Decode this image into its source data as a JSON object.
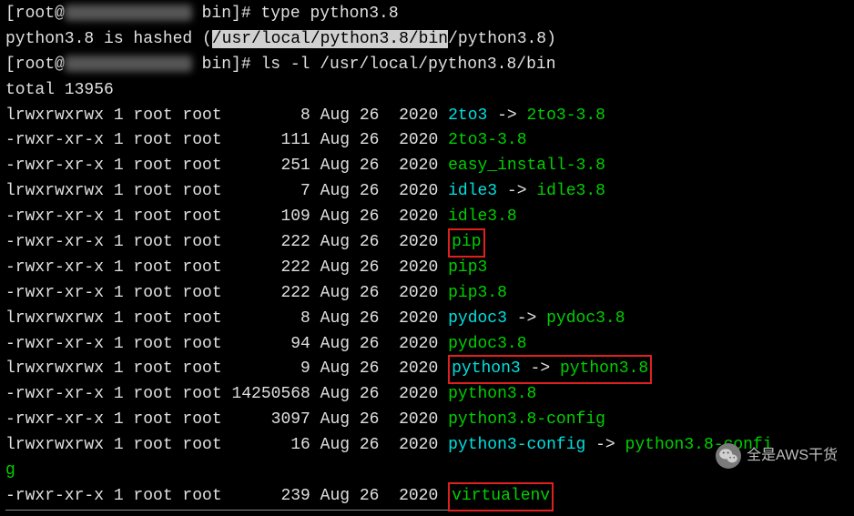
{
  "prompt_user": "root",
  "prompt_dir": "bin",
  "cmd1": "type python3.8",
  "hash_line_pre": "python3.8 is hashed (",
  "hash_highlight": "/usr/local/python3.8/bin",
  "hash_line_post": "/python3.8)",
  "cmd2": "ls -l /usr/local/python3.8/bin",
  "total_line": "total 13956",
  "rows": [
    {
      "perm": "lrwxrwxrwx",
      "links": "1",
      "owner": "root",
      "group": "root",
      "size": "       8",
      "date": "Aug 26  2020",
      "name": "2to3",
      "link": "2to3-3.8",
      "color": "cyan",
      "tcolor": "green"
    },
    {
      "perm": "-rwxr-xr-x",
      "links": "1",
      "owner": "root",
      "group": "root",
      "size": "     111",
      "date": "Aug 26  2020",
      "name": "2to3-3.8",
      "color": "green"
    },
    {
      "perm": "-rwxr-xr-x",
      "links": "1",
      "owner": "root",
      "group": "root",
      "size": "     251",
      "date": "Aug 26  2020",
      "name": "easy_install-3.8",
      "color": "green"
    },
    {
      "perm": "lrwxrwxrwx",
      "links": "1",
      "owner": "root",
      "group": "root",
      "size": "       7",
      "date": "Aug 26  2020",
      "name": "idle3",
      "link": "idle3.8",
      "color": "cyan",
      "tcolor": "green"
    },
    {
      "perm": "-rwxr-xr-x",
      "links": "1",
      "owner": "root",
      "group": "root",
      "size": "     109",
      "date": "Aug 26  2020",
      "name": "idle3.8",
      "color": "green"
    },
    {
      "perm": "-rwxr-xr-x",
      "links": "1",
      "owner": "root",
      "group": "root",
      "size": "     222",
      "date": "Aug 26  2020",
      "name": "pip",
      "color": "green",
      "box": true
    },
    {
      "perm": "-rwxr-xr-x",
      "links": "1",
      "owner": "root",
      "group": "root",
      "size": "     222",
      "date": "Aug 26  2020",
      "name": "pip3",
      "color": "green"
    },
    {
      "perm": "-rwxr-xr-x",
      "links": "1",
      "owner": "root",
      "group": "root",
      "size": "     222",
      "date": "Aug 26  2020",
      "name": "pip3.8",
      "color": "green"
    },
    {
      "perm": "lrwxrwxrwx",
      "links": "1",
      "owner": "root",
      "group": "root",
      "size": "       8",
      "date": "Aug 26  2020",
      "name": "pydoc3",
      "link": "pydoc3.8",
      "color": "cyan",
      "tcolor": "green"
    },
    {
      "perm": "-rwxr-xr-x",
      "links": "1",
      "owner": "root",
      "group": "root",
      "size": "      94",
      "date": "Aug 26  2020",
      "name": "pydoc3.8",
      "color": "green"
    },
    {
      "perm": "lrwxrwxrwx",
      "links": "1",
      "owner": "root",
      "group": "root",
      "size": "       9",
      "date": "Aug 26  2020",
      "name": "python3",
      "link": "python3.8",
      "color": "cyan",
      "tcolor": "green",
      "box": true
    },
    {
      "perm": "-rwxr-xr-x",
      "links": "1",
      "owner": "root",
      "group": "root",
      "size": "14250568",
      "date": "Aug 26  2020",
      "name": "python3.8",
      "color": "green"
    },
    {
      "perm": "-rwxr-xr-x",
      "links": "1",
      "owner": "root",
      "group": "root",
      "size": "    3097",
      "date": "Aug 26  2020",
      "name": "python3.8-config",
      "color": "green"
    },
    {
      "perm": "lrwxrwxrwx",
      "links": "1",
      "owner": "root",
      "group": "root",
      "size": "      16",
      "date": "Aug 26  2020",
      "name": "python3-config",
      "link": "python3.8-config",
      "color": "cyan",
      "tcolor": "green",
      "wrap": true
    },
    {
      "perm": "-rwxr-xr-x",
      "links": "1",
      "owner": "root",
      "group": "root",
      "size": "     239",
      "date": "Aug 26  2020",
      "name": "virtualenv",
      "color": "green",
      "box": true,
      "underline": true
    }
  ],
  "wrap_tail": "g",
  "wechat_label": "全是AWS干货"
}
